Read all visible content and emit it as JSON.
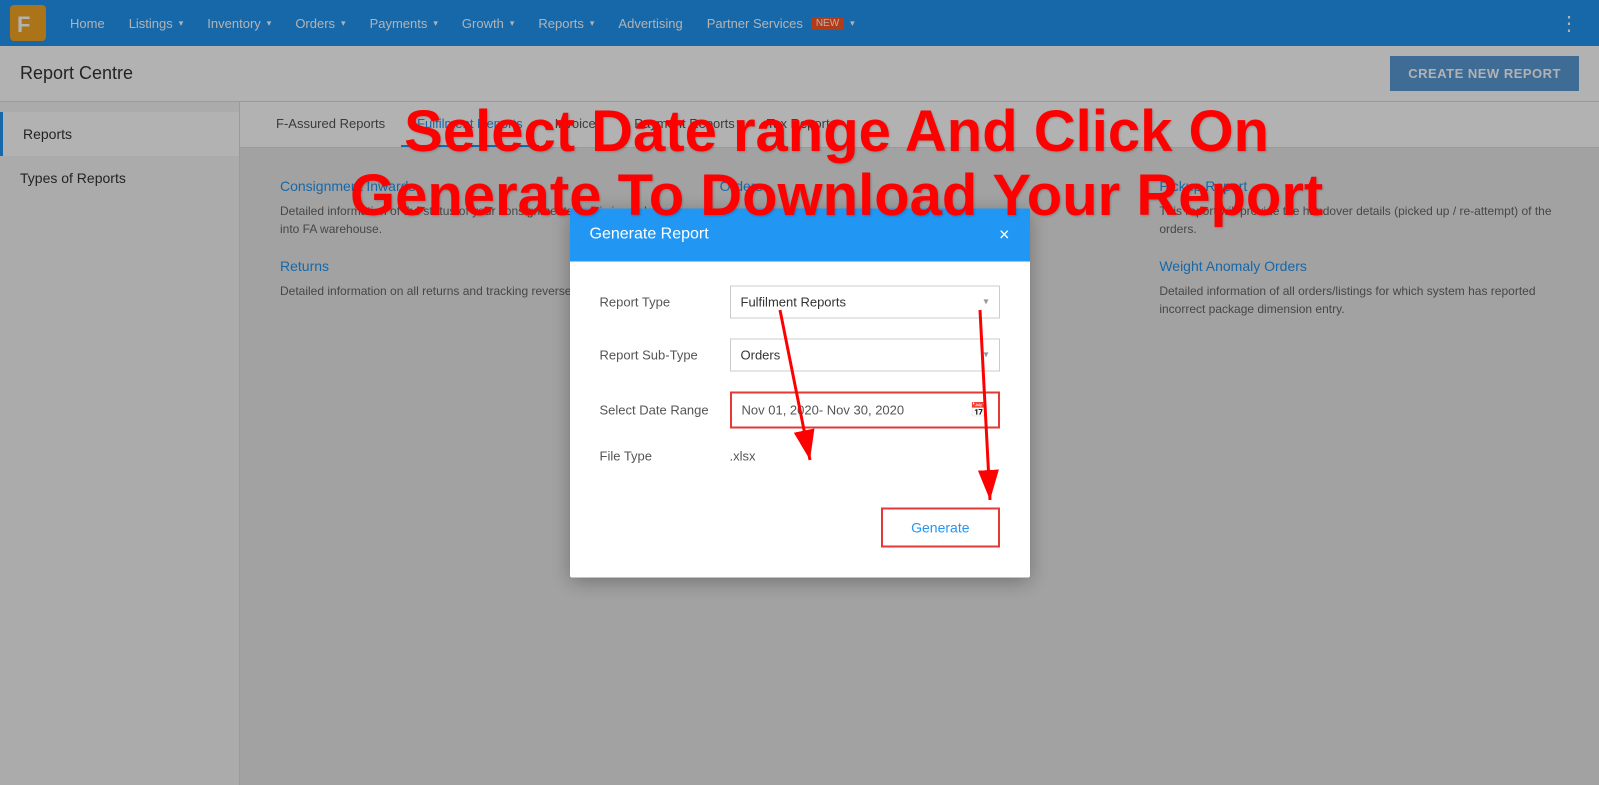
{
  "navbar": {
    "logo_text": "F",
    "items": [
      {
        "label": "Home",
        "has_dropdown": false
      },
      {
        "label": "Listings",
        "has_dropdown": true
      },
      {
        "label": "Inventory",
        "has_dropdown": true
      },
      {
        "label": "Orders",
        "has_dropdown": true
      },
      {
        "label": "Payments",
        "has_dropdown": true
      },
      {
        "label": "Growth",
        "has_dropdown": true
      },
      {
        "label": "Reports",
        "has_dropdown": true
      },
      {
        "label": "Advertising",
        "has_dropdown": false
      },
      {
        "label": "Partner Services",
        "has_dropdown": true,
        "badge": "NEW"
      }
    ]
  },
  "page": {
    "title": "Report Centre",
    "create_button": "CREATE NEW REPORT"
  },
  "sidebar": {
    "items": [
      {
        "label": "Reports",
        "active": true
      },
      {
        "label": "Types of Reports",
        "active": false
      }
    ]
  },
  "sub_tabs": [
    {
      "label": "F-Assured Reports",
      "active": false
    },
    {
      "label": "Fulfilment Reports",
      "active": true
    },
    {
      "label": "Invoices",
      "active": false
    },
    {
      "label": "Payment Reports",
      "active": false
    },
    {
      "label": "Tax Reports",
      "active": false
    }
  ],
  "reports": [
    {
      "name": "Consignment Inwards",
      "desc": "Detailed information of the status of your consignments that is inwarded into FA warehouse."
    },
    {
      "name": "Orders",
      "desc": ""
    },
    {
      "name": "Pickup Report",
      "desc": "This report will provide the handover details (picked up / re-attempt) of the orders."
    },
    {
      "name": "Returns",
      "desc": "Detailed information on all returns and tracking reverse shipments' status."
    },
    {
      "name": "",
      "desc": ""
    },
    {
      "name": "Weight Anomaly Orders",
      "desc": "Detailed information of all orders/listings for which system has reported incorrect package dimension entry."
    }
  ],
  "modal": {
    "title": "Generate Report",
    "close_label": "×",
    "report_type_label": "Report Type",
    "report_type_value": "Fulfilment Reports",
    "report_sub_type_label": "Report Sub-Type",
    "report_sub_type_value": "Orders",
    "date_range_label": "Select Date Range",
    "date_range_value": "Nov 01, 2020- Nov 30, 2020",
    "file_type_label": "File Type",
    "file_type_value": ".xlsx",
    "generate_button": "Generate"
  },
  "annotation": {
    "line1": "Select Date range And Click On",
    "line2": "Generate To Download Your Report"
  }
}
